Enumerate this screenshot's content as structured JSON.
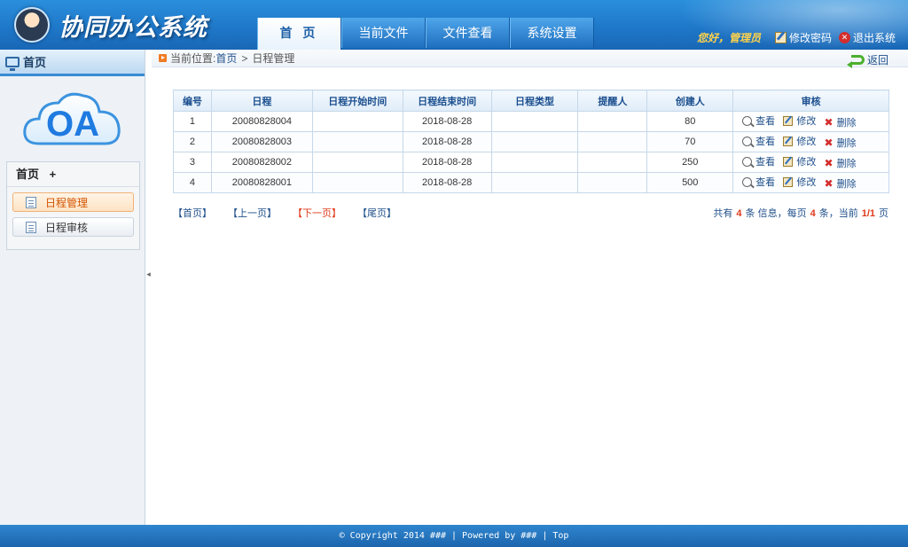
{
  "header": {
    "app_title": "协同办公系统",
    "nav_tabs": [
      {
        "label": "首 页"
      },
      {
        "label": "当前文件"
      },
      {
        "label": "文件查看"
      },
      {
        "label": "系统设置"
      }
    ],
    "greeting": "您好，管理员",
    "change_password": "修改密码",
    "logout": "退出系统"
  },
  "sidebar": {
    "head_title": "首页",
    "logo_text": "OA",
    "menu_title": "首页",
    "menu_toggle": "+",
    "items": [
      {
        "label": "日程管理"
      },
      {
        "label": "日程审核"
      }
    ]
  },
  "breadcrumb": {
    "prefix": "当前位置:",
    "home": "首页",
    "sep": ">",
    "current": "日程管理",
    "back": "返回"
  },
  "table": {
    "columns": [
      "编号",
      "日程",
      "日程开始时间",
      "日程结束时间",
      "日程类型",
      "提醒人",
      "创建人",
      "审核"
    ],
    "rows": [
      {
        "id": "1",
        "schedule": "20080828004",
        "start": "",
        "end": "2018-08-28",
        "type": "",
        "reminder": "",
        "creator": "80"
      },
      {
        "id": "2",
        "schedule": "20080828003",
        "start": "",
        "end": "2018-08-28",
        "type": "",
        "reminder": "",
        "creator": "70"
      },
      {
        "id": "3",
        "schedule": "20080828002",
        "start": "",
        "end": "2018-08-28",
        "type": "",
        "reminder": "",
        "creator": "250"
      },
      {
        "id": "4",
        "schedule": "20080828001",
        "start": "",
        "end": "2018-08-28",
        "type": "",
        "reminder": "",
        "creator": "500"
      }
    ],
    "actions": {
      "view": "查看",
      "edit": "修改",
      "delete": "删除"
    }
  },
  "pager": {
    "first": "【首页】",
    "prev": "【上一页】",
    "next": "【下一页】",
    "last": "【尾页】",
    "info_total_prefix": "共有",
    "total": "4",
    "info_total_suffix": "条 信息，每页",
    "per_page": "4",
    "info_page_suffix": "条，当前",
    "current": "1/1",
    "info_end": "页"
  },
  "footer": {
    "copyright": "© Copyright 2014 ###",
    "powered": "Powered by ###",
    "top": "Top"
  },
  "colors": {
    "header_blue": "#1f78c9",
    "accent_orange": "#e03a1a",
    "link_blue": "#1f4f8a"
  }
}
